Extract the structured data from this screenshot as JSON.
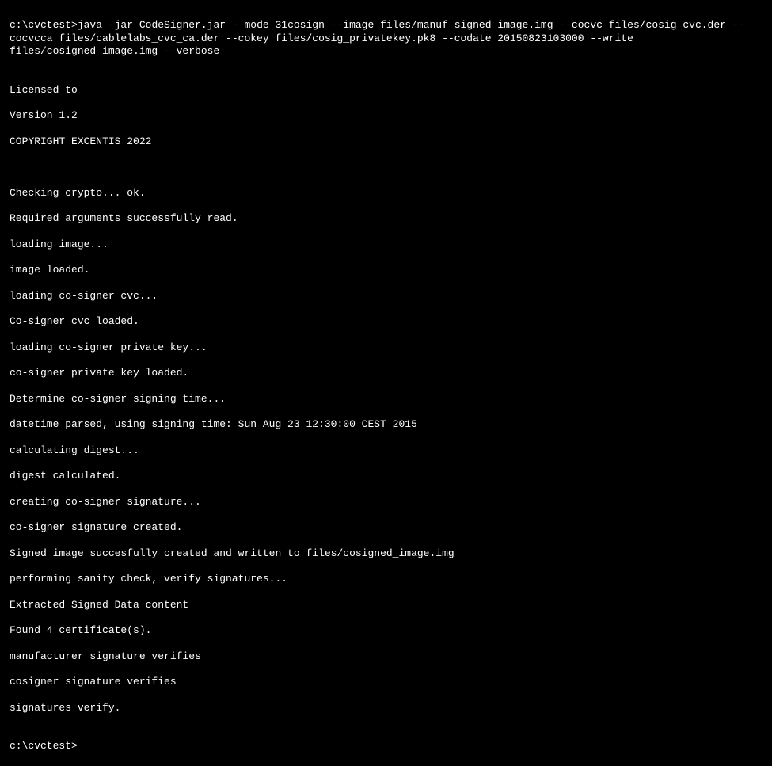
{
  "terminal": {
    "prompt1": "c:\\cvctest>",
    "command": "java -jar CodeSigner.jar --mode 31cosign --image files/manuf_signed_image.img --cocvc files/cosig_cvc.der --cocvcca files/cablelabs_cvc_ca.der --cokey files/cosig_privatekey.pk8 --codate 20150823103000 --write files/cosigned_image.img --verbose",
    "output": {
      "blank1": "",
      "licensed": "Licensed to",
      "version": "Version 1.2",
      "copyright": "COPYRIGHT EXCENTIS 2022",
      "blank2": "",
      "blank3": "",
      "crypto": "Checking crypto... ok.",
      "args": "Required arguments successfully read.",
      "loading_image": "loading image...",
      "image_loaded": "image loaded.",
      "loading_cvc": "loading co-signer cvc...",
      "cvc_loaded": "Co-signer cvc loaded.",
      "loading_key": "loading co-signer private key...",
      "key_loaded": "co-signer private key loaded.",
      "determine_time": "Determine co-signer signing time...",
      "datetime": "datetime parsed, using signing time: Sun Aug 23 12:30:00 CEST 2015",
      "calculating": "calculating digest...",
      "calculated": "digest calculated.",
      "creating_sig": "creating co-signer signature...",
      "sig_created": "co-signer signature created.",
      "written": "Signed image succesfully created and written to files/cosigned_image.img",
      "sanity": "performing sanity check, verify signatures...",
      "extracted": "Extracted Signed Data content",
      "found_certs": "Found 4 certificate(s).",
      "manuf_verify": "manufacturer signature verifies",
      "cosigner_verify": "cosigner signature verifies",
      "sig_verify": "signatures verify.",
      "blank4": ""
    },
    "prompt2": "c:\\cvctest>"
  }
}
